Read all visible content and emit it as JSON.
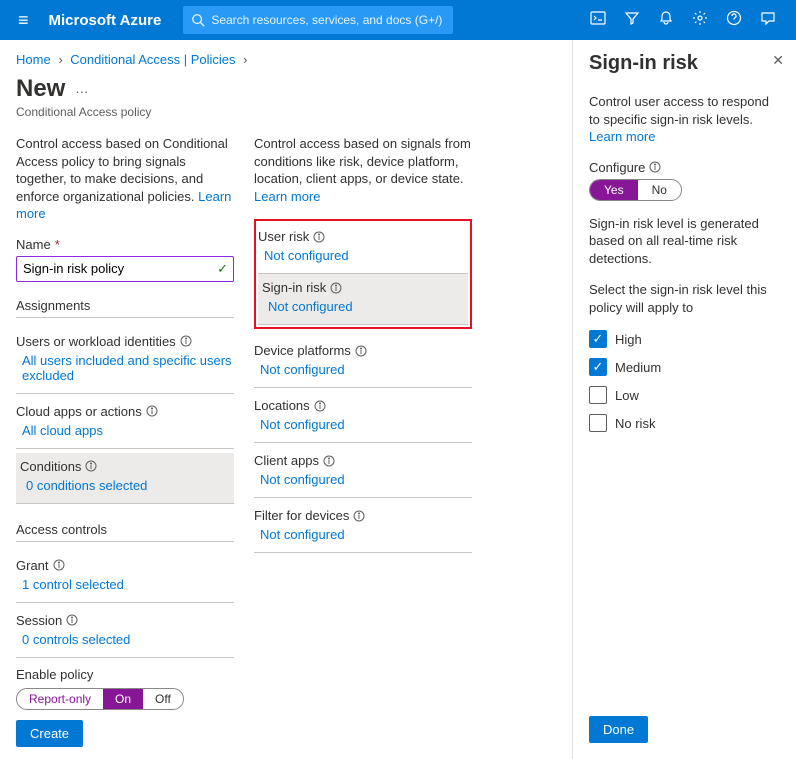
{
  "header": {
    "brand": "Microsoft Azure",
    "search_placeholder": "Search resources, services, and docs (G+/)"
  },
  "breadcrumb": {
    "home": "Home",
    "ca": "Conditional Access | Policies"
  },
  "page": {
    "title": "New",
    "subtitle": "Conditional Access policy"
  },
  "left": {
    "descr": "Control access based on Conditional Access policy to bring signals together, to make decisions, and enforce organizational policies.",
    "learn": "Learn more",
    "name_label": "Name",
    "name_value": "Sign-in risk policy",
    "assignments": "Assignments",
    "users_label": "Users or workload identities",
    "users_value": "All users included and specific users excluded",
    "cloud_label": "Cloud apps or actions",
    "cloud_value": "All cloud apps",
    "cond_label": "Conditions",
    "cond_value": "0 conditions selected",
    "access_controls": "Access controls",
    "grant_label": "Grant",
    "grant_value": "1 control selected",
    "session_label": "Session",
    "session_value": "0 controls selected"
  },
  "right": {
    "descr": "Control access based on signals from conditions like risk, device platform, location, client apps, or device state.",
    "learn": "Learn more",
    "user_risk": "User risk",
    "signin_risk": "Sign-in risk",
    "device_platforms": "Device platforms",
    "locations": "Locations",
    "client_apps": "Client apps",
    "filter_devices": "Filter for devices",
    "not_configured": "Not configured"
  },
  "bottom": {
    "enable_label": "Enable policy",
    "report_only": "Report-only",
    "on": "On",
    "off": "Off",
    "create": "Create"
  },
  "panel": {
    "title": "Sign-in risk",
    "descr": "Control user access to respond to specific sign-in risk levels.",
    "learn": "Learn more",
    "configure": "Configure",
    "yes": "Yes",
    "no": "No",
    "descr2": "Sign-in risk level is generated based on all real-time risk detections.",
    "select_label": "Select the sign-in risk level this policy will apply to",
    "high": "High",
    "medium": "Medium",
    "low": "Low",
    "norisk": "No risk",
    "done": "Done"
  }
}
